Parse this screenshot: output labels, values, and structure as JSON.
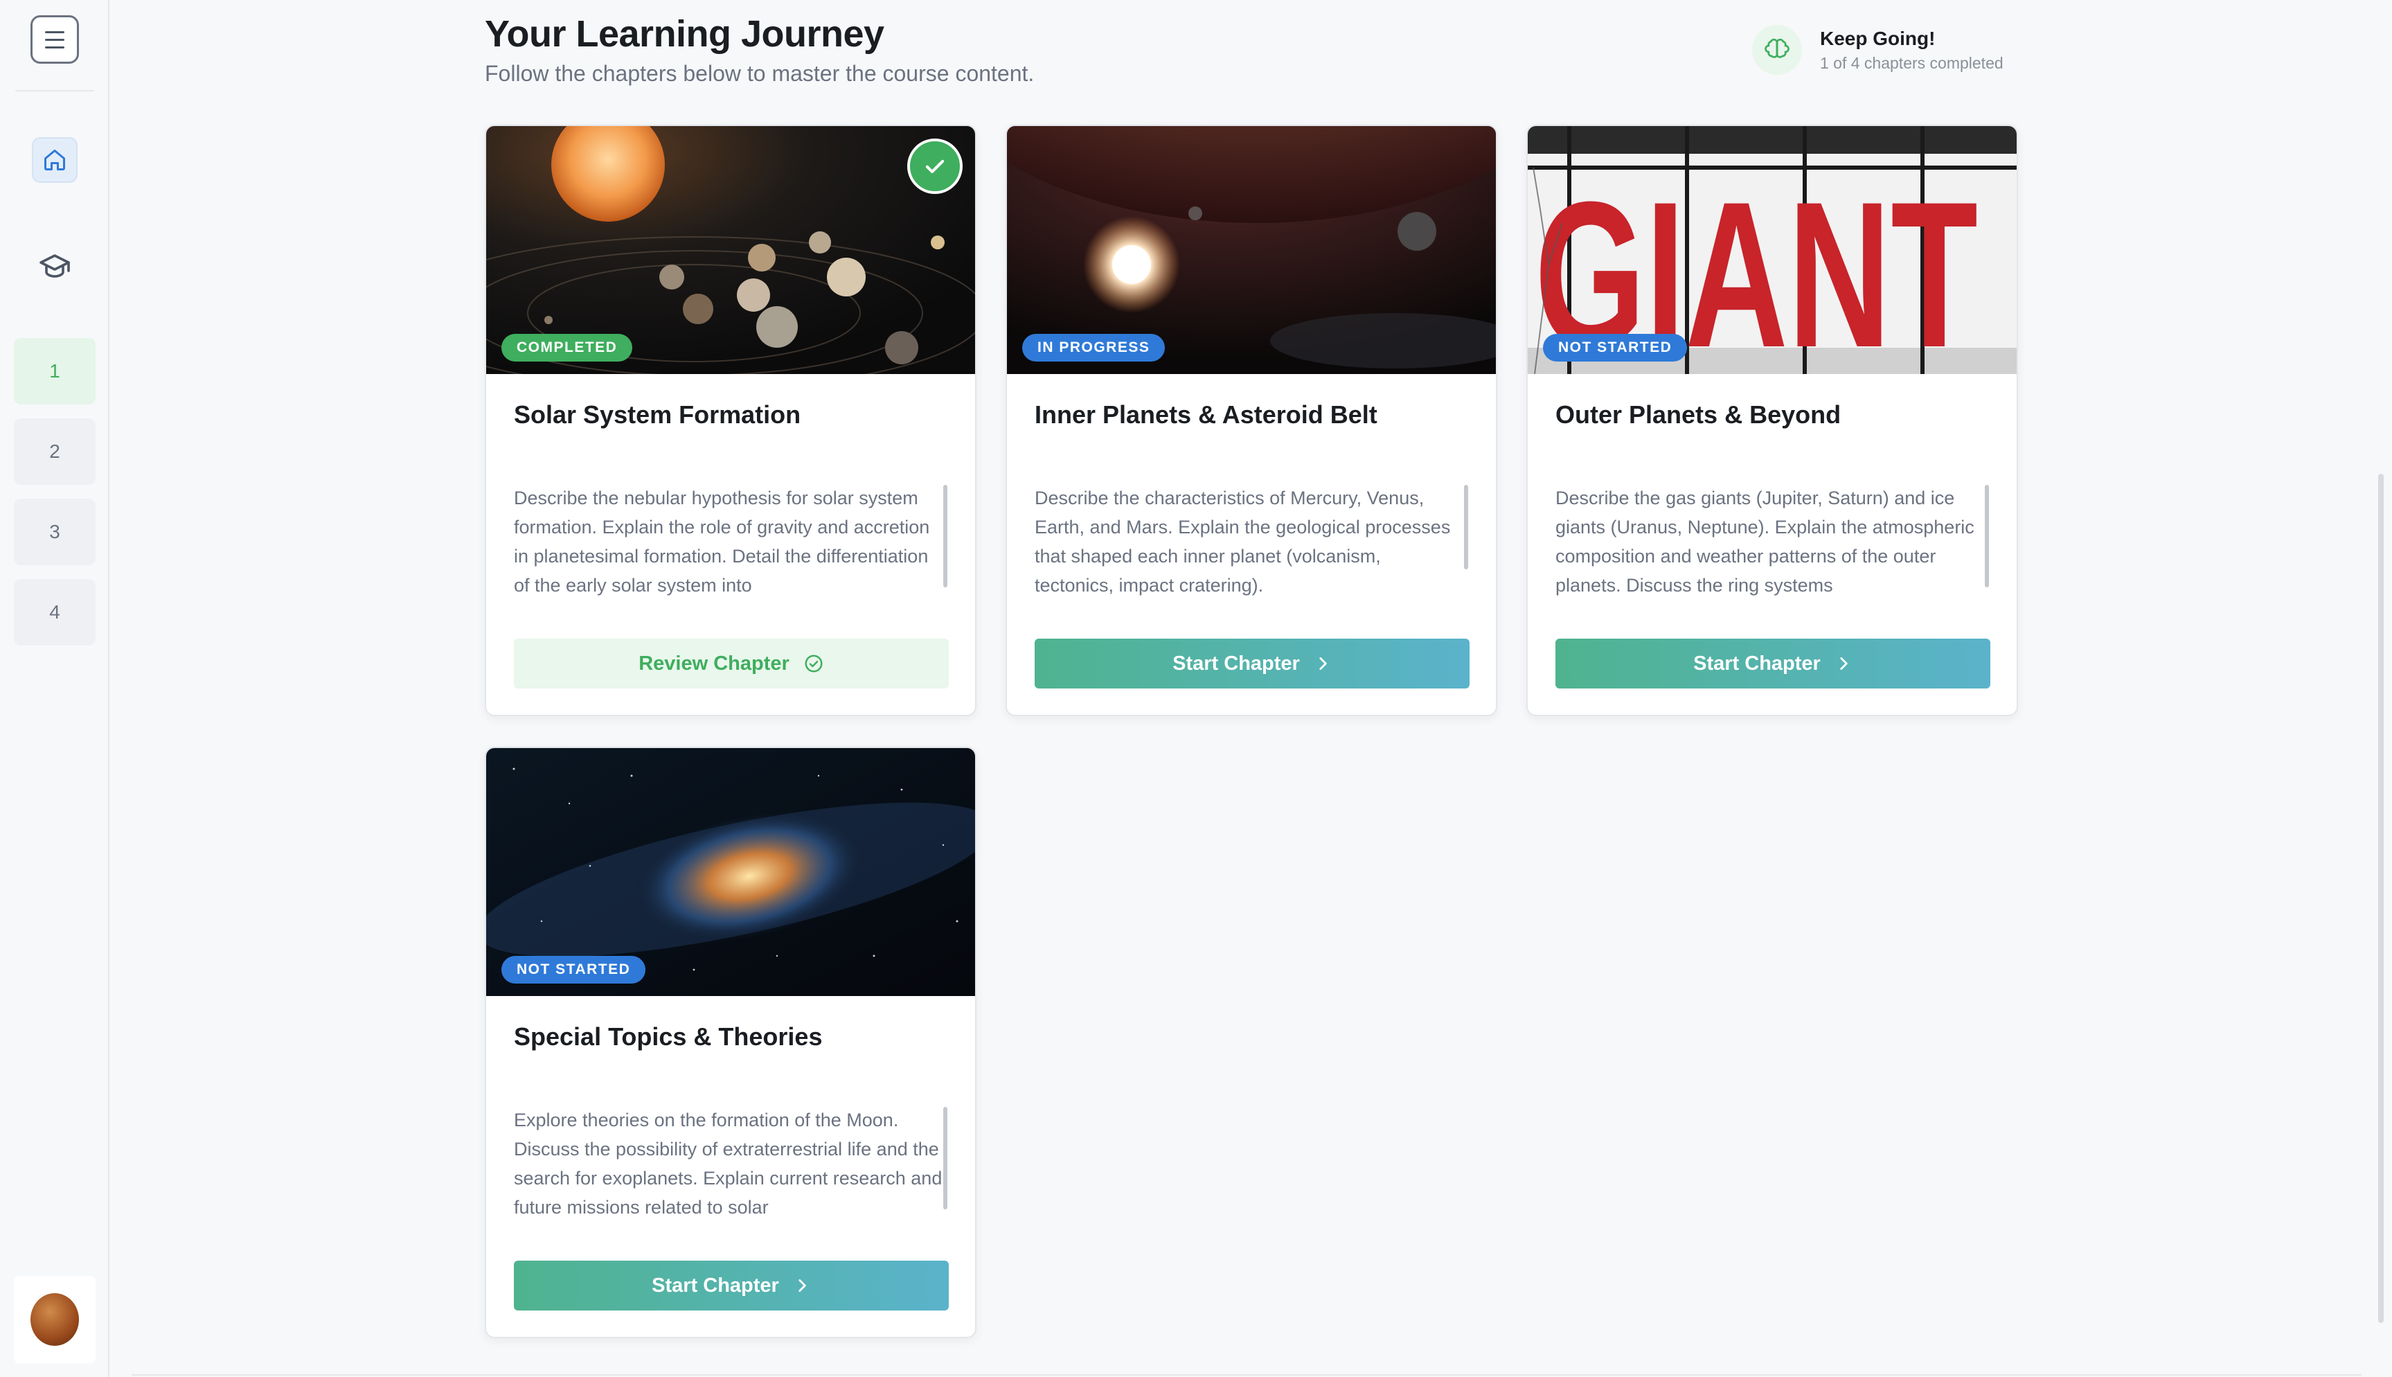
{
  "header": {
    "title": "Your Learning Journey",
    "subtitle": "Follow the chapters below to master the course content."
  },
  "progress": {
    "title": "Keep Going!",
    "subtitle": "1 of 4 chapters completed",
    "completed": 1,
    "total": 4,
    "icon": "brain-icon"
  },
  "sidebar": {
    "menu_icon": "menu-icon",
    "home_icon": "home-icon",
    "courses_icon": "graduation-cap-icon",
    "chapters": [
      "1",
      "2",
      "3",
      "4"
    ],
    "active_chapter": "1"
  },
  "cards": [
    {
      "title": "Solar System Formation",
      "status": "COMPLETED",
      "description": "Describe the nebular hypothesis for solar system formation. Explain the role of gravity and accretion in planetesimal formation. Detail the differentiation of the early solar system into",
      "button": "Review Chapter",
      "button_icon": "check-circle-icon"
    },
    {
      "title": "Inner Planets & Asteroid Belt",
      "status": "IN PROGRESS",
      "description": "Describe the characteristics of Mercury, Venus, Earth, and Mars. Explain the geological processes that shaped each inner planet (volcanism, tectonics, impact cratering).",
      "button": "Start Chapter",
      "button_icon": "chevron-right-icon"
    },
    {
      "title": "Outer Planets & Beyond",
      "status": "NOT STARTED",
      "description": "Describe the gas giants (Jupiter, Saturn) and ice giants (Uranus, Neptune). Explain the atmospheric composition and weather patterns of the outer planets. Discuss the ring systems",
      "button": "Start Chapter",
      "button_icon": "chevron-right-icon",
      "image_text": "GIANT"
    },
    {
      "title": "Special Topics & Theories",
      "status": "NOT STARTED",
      "description": "Explore theories on the formation of the Moon. Discuss the possibility of extraterrestrial life and the search for exoplanets. Explain current research and future missions related to solar",
      "button": "Start Chapter",
      "button_icon": "chevron-right-icon"
    }
  ],
  "colors": {
    "accent_green": "#3fae5e",
    "accent_blue": "#2f7ad8",
    "button_gradient_start": "#4fb38f",
    "button_gradient_end": "#5ab3cb"
  }
}
